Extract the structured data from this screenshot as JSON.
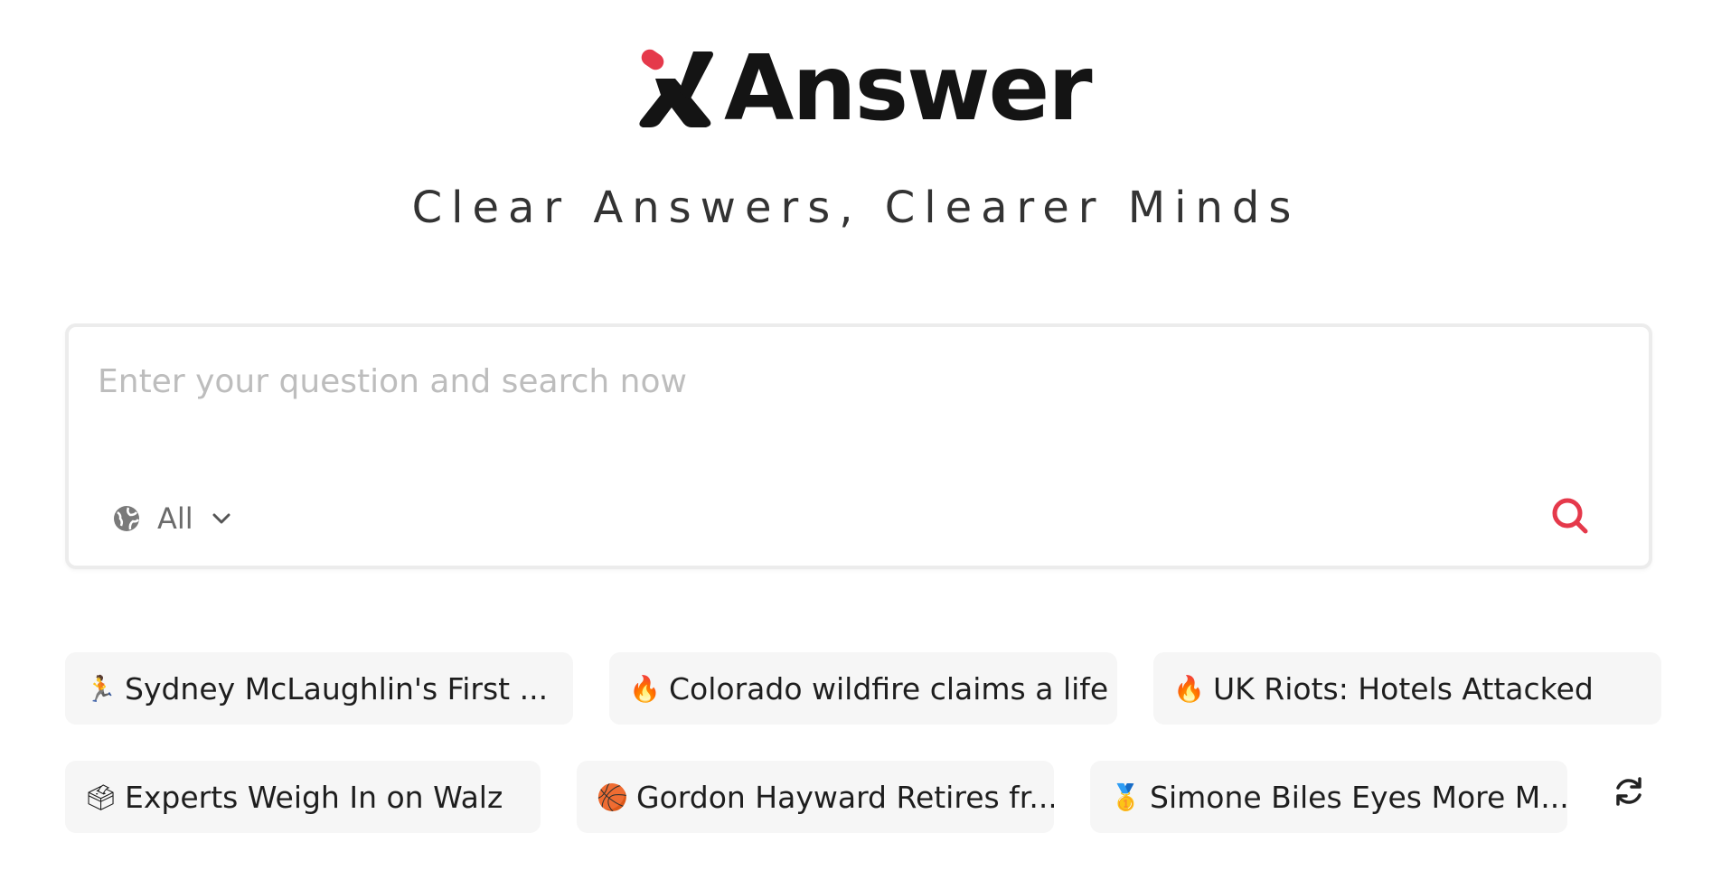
{
  "brand": {
    "name": "Answer",
    "tagline": "Clear Answers, Clearer Minds",
    "accent_color": "#e5394b"
  },
  "search": {
    "placeholder": "Enter your question and search now",
    "value": "",
    "scope": {
      "selected": "All",
      "icon": "globe-icon"
    },
    "submit_icon": "search-icon"
  },
  "suggestions": {
    "row1": [
      {
        "emoji": "🏃",
        "text": "Sydney McLaughlin's First ..."
      },
      {
        "emoji": "🔥",
        "text": "Colorado wildfire claims a life"
      },
      {
        "emoji": "🔥",
        "text": "UK Riots: Hotels Attacked"
      }
    ],
    "row2": [
      {
        "emoji": "🗳",
        "text": "Experts Weigh In on Walz"
      },
      {
        "emoji": "🏀",
        "text": "Gordon Hayward Retires fr..."
      },
      {
        "emoji": "🥇",
        "text": "Simone Biles Eyes More M..."
      }
    ],
    "refresh_icon": "refresh-icon"
  }
}
